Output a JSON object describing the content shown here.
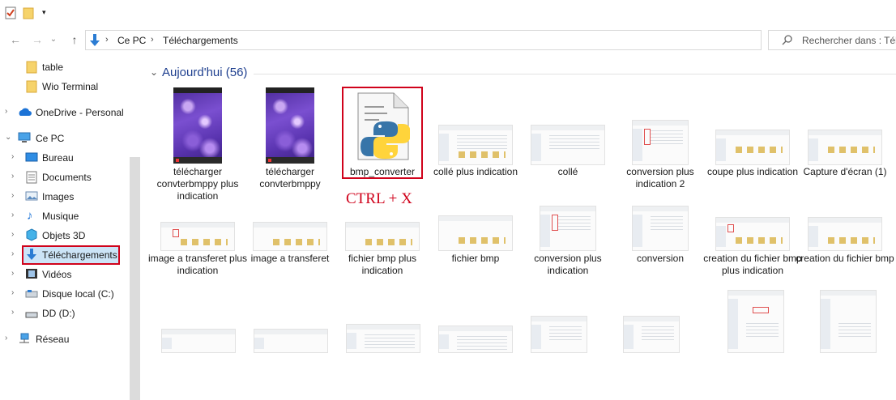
{
  "address": {
    "root": "Ce PC",
    "current": "Téléchargements"
  },
  "search": {
    "placeholder": "Rechercher dans : Télécha..."
  },
  "sidebar": {
    "items": [
      {
        "label": "table"
      },
      {
        "label": "Wio Terminal"
      },
      {
        "label": "OneDrive - Personal"
      },
      {
        "label": "Ce PC"
      },
      {
        "label": "Bureau"
      },
      {
        "label": "Documents"
      },
      {
        "label": "Images"
      },
      {
        "label": "Musique"
      },
      {
        "label": "Objets 3D"
      },
      {
        "label": "Téléchargements"
      },
      {
        "label": "Vidéos"
      },
      {
        "label": "Disque local (C:)"
      },
      {
        "label": "DD (D:)"
      },
      {
        "label": "Réseau"
      }
    ]
  },
  "content": {
    "group_label": "Aujourd'hui (56)",
    "files": [
      {
        "name": "télécharger convterbmppy plus indication"
      },
      {
        "name": "télécharger convterbmppy"
      },
      {
        "name": "bmp_converter"
      },
      {
        "name": "collé plus indication"
      },
      {
        "name": "collé"
      },
      {
        "name": "conversion plus indication 2"
      },
      {
        "name": "coupe plus indication"
      },
      {
        "name": "Capture d'écran (1)"
      },
      {
        "name": "image a transferet plus indication"
      },
      {
        "name": "image a transferet"
      },
      {
        "name": "fichier bmp plus indication"
      },
      {
        "name": "fichier bmp"
      },
      {
        "name": "conversion plus indication"
      },
      {
        "name": "conversion"
      },
      {
        "name": "creation du fichier bmp plus indication"
      },
      {
        "name": "creation du fichier bmp"
      }
    ],
    "annotation": "CTRL + X"
  },
  "colors": {
    "highlight": "#d0021b",
    "selection": "#cce4f7",
    "group_header": "#1e3f8f",
    "nav_arrow": "#2b7cd3"
  }
}
